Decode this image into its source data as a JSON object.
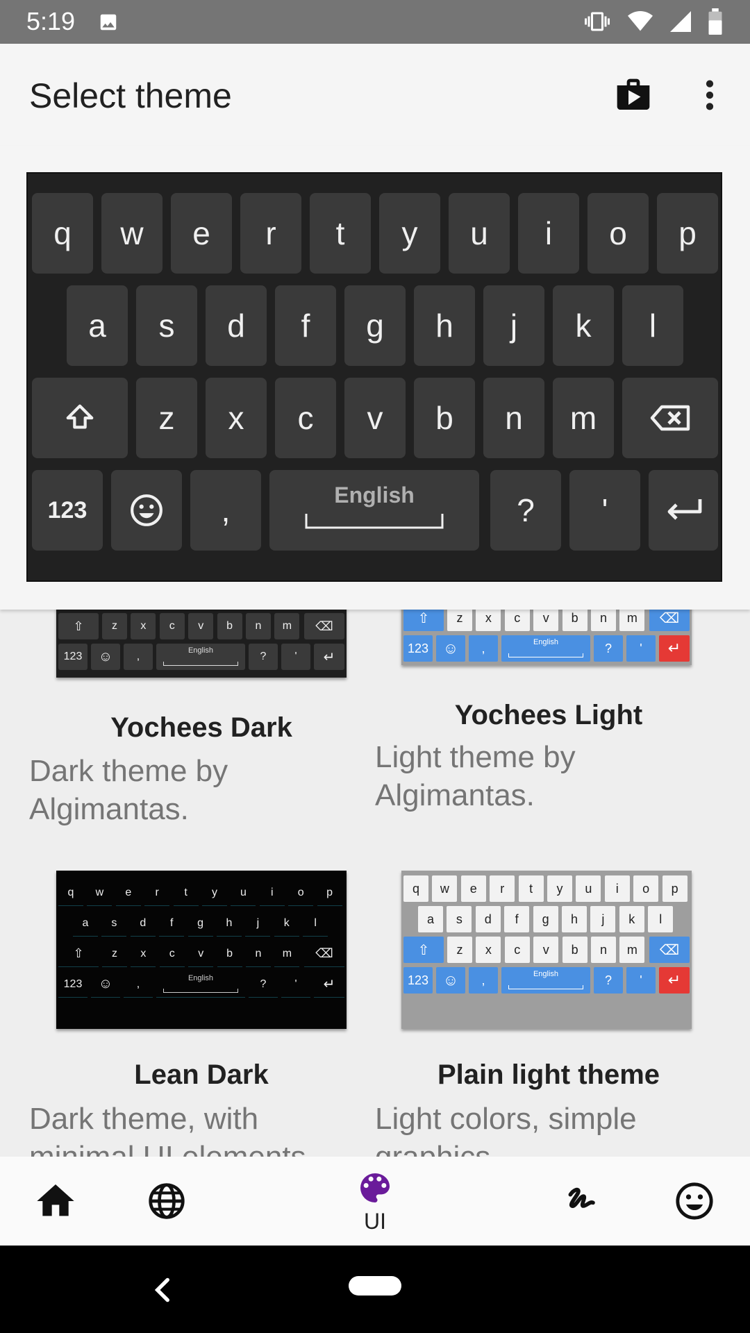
{
  "status_bar": {
    "time": "5:19",
    "left_icons": [
      "image-icon"
    ],
    "right_icons": [
      "vibrate-icon",
      "wifi-icon",
      "signal-icon",
      "battery-icon"
    ]
  },
  "app_bar": {
    "title": "Select theme",
    "actions": [
      "play-store-icon",
      "more-vert-icon"
    ]
  },
  "preview": {
    "row1": [
      "q",
      "w",
      "e",
      "r",
      "t",
      "y",
      "u",
      "i",
      "o",
      "p"
    ],
    "row2": [
      "a",
      "s",
      "d",
      "f",
      "g",
      "h",
      "j",
      "k",
      "l"
    ],
    "row3": [
      "z",
      "x",
      "c",
      "v",
      "b",
      "n",
      "m"
    ],
    "key_123": "123",
    "key_comma": ",",
    "space_label": "English",
    "key_question": "?",
    "key_apostrophe": "'",
    "colors": {
      "background": "#212121",
      "key": "#3a3a3a",
      "text": "#f0f0f0"
    }
  },
  "themes": [
    {
      "name": "Yochees Dark",
      "description": "Dark theme by Algimantas."
    },
    {
      "name": "Yochees Light",
      "description": "Light theme by Algimantas."
    },
    {
      "name": "Lean Dark",
      "description": "Dark theme, with minimal UI elements."
    },
    {
      "name": "Plain light theme",
      "description": "Light colors, simple graphics."
    }
  ],
  "mini_keyboard": {
    "row1": [
      "q",
      "w",
      "e",
      "r",
      "t",
      "y",
      "u",
      "i",
      "o",
      "p"
    ],
    "row2": [
      "a",
      "s",
      "d",
      "f",
      "g",
      "h",
      "j",
      "k",
      "l"
    ],
    "row3": [
      "z",
      "x",
      "c",
      "v",
      "b",
      "n",
      "m"
    ],
    "key_123": "123",
    "key_comma": ",",
    "space_label": "English",
    "key_question": "?",
    "key_apostrophe": "'"
  },
  "bottom_nav": {
    "items": [
      {
        "icon": "home-icon"
      },
      {
        "icon": "globe-icon"
      },
      {
        "icon": "palette-icon",
        "label": "UI",
        "active": true
      },
      {
        "icon": "gesture-icon"
      },
      {
        "icon": "emoji-icon"
      }
    ],
    "active_color": "#6a1b9a"
  },
  "system_nav": {
    "icons": [
      "back-icon",
      "home-pill-icon"
    ]
  }
}
